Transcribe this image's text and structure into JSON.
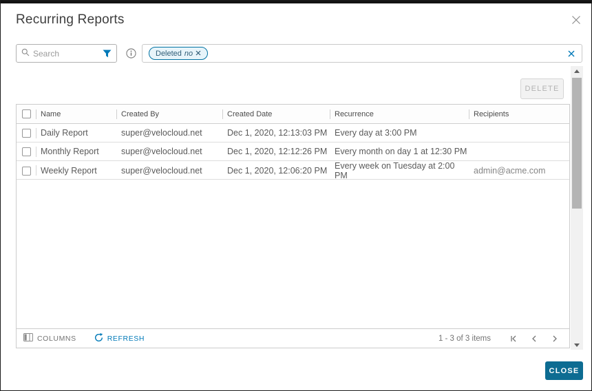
{
  "dialog": {
    "title": "Recurring Reports"
  },
  "toolbar": {
    "search": {
      "placeholder": "Search",
      "value": ""
    },
    "filter_chip": {
      "field": "Deleted",
      "value": "no"
    }
  },
  "actions": {
    "delete_label": "DELETE"
  },
  "table": {
    "columns": [
      "Name",
      "Created By",
      "Created Date",
      "Recurrence",
      "Recipients"
    ],
    "rows": [
      {
        "name": "Daily Report",
        "created_by": "super@velocloud.net",
        "created_date": "Dec 1, 2020, 12:13:03 PM",
        "recurrence": "Every day at 3:00 PM",
        "recipients": ""
      },
      {
        "name": "Monthly Report",
        "created_by": "super@velocloud.net",
        "created_date": "Dec 1, 2020, 12:12:26 PM",
        "recurrence": "Every month on day 1 at 12:30 PM",
        "recipients": ""
      },
      {
        "name": "Weekly Report",
        "created_by": "super@velocloud.net",
        "created_date": "Dec 1, 2020, 12:06:20 PM",
        "recurrence": "Every week on Tuesday at 2:00 PM",
        "recipients": "admin@acme.com"
      }
    ],
    "footer": {
      "columns_label": "COLUMNS",
      "refresh_label": "REFRESH",
      "pagination_text": "1 - 3 of 3 items"
    }
  },
  "footer_actions": {
    "close_label": "CLOSE"
  },
  "colors": {
    "primary_button": "#0d6c92",
    "link_blue": "#0079b8",
    "chip_border": "#0072a3",
    "chip_bg": "#e7f4fa"
  }
}
